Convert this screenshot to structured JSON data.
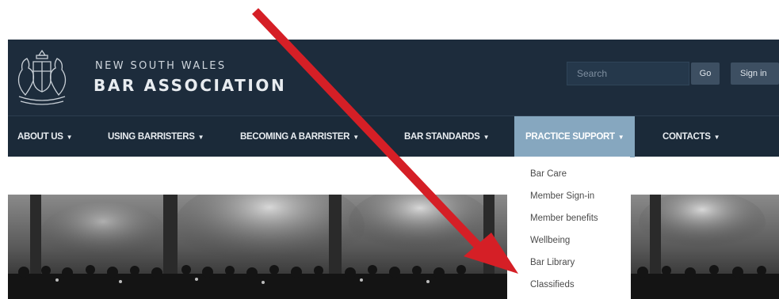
{
  "header": {
    "org_line1": "NEW SOUTH WALES",
    "org_line2": "BAR ASSOCIATION",
    "search_placeholder": "Search",
    "go_label": "Go",
    "signin_label": "Sign in"
  },
  "nav": {
    "items": [
      {
        "label": "ABOUT US"
      },
      {
        "label": "USING BARRISTERS"
      },
      {
        "label": "BECOMING A BARRISTER"
      },
      {
        "label": "BAR STANDARDS"
      },
      {
        "label": "PRACTICE SUPPORT",
        "active": true
      },
      {
        "label": "CONTACTS"
      }
    ],
    "caret_icon": "caret-down-icon",
    "active_color": "#86a7bf"
  },
  "dropdown": {
    "items": [
      {
        "label": "Bar Care"
      },
      {
        "label": "Member Sign-in"
      },
      {
        "label": "Member benefits"
      },
      {
        "label": "Wellbeing"
      },
      {
        "label": "Bar Library"
      },
      {
        "label": "Classifieds"
      }
    ]
  },
  "colors": {
    "header_bg": "#1d2c3c",
    "nav_bg": "#1b2a39",
    "arrow": "#d51f26"
  }
}
